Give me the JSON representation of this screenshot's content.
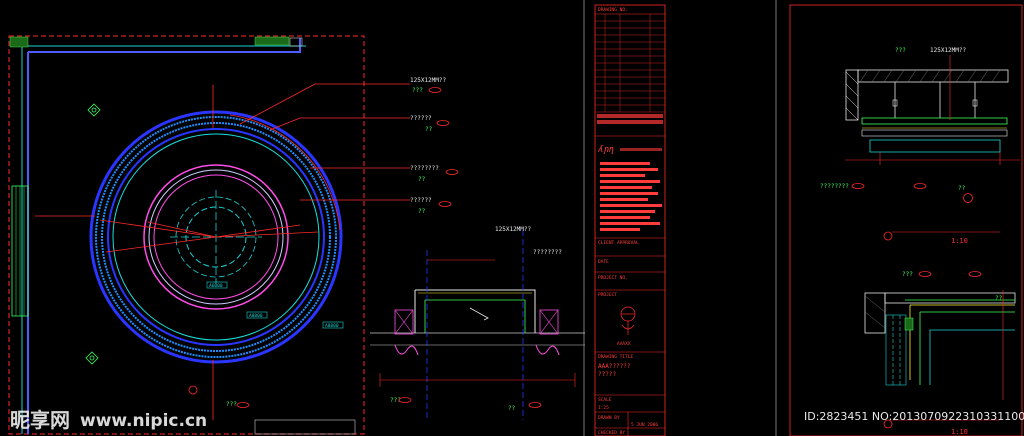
{
  "plan": {
    "dim_125": "125X12MM??",
    "ques": "???",
    "ques2": "??",
    "q_long": "????????",
    "q_mid": "??????",
    "tag_a": "A6000",
    "tag_b": "A8800",
    "tag_c": "A8800"
  },
  "section_a": {
    "dim_125": "125X12MM??",
    "q_long": "????????",
    "ques": "???",
    "ques2": "??"
  },
  "title_block": {
    "label_drawing_no": "DRAWING NO.",
    "label_client": "CLIENT APPROVAL",
    "label_date": "DATE",
    "label_project": "PROJECT NO.",
    "label_proj_title": "PROJECT",
    "label_drawing_title": "DRAWING TITLE",
    "title_value": "AAA??????",
    "title_sub": "?????",
    "label_scale": "SCALE",
    "scale_value": "1:25",
    "label_drawn": "DRAWN BY",
    "date_value": "5 JUN 2006",
    "label_checked": "CHECKED BY",
    "stamp": "AAAXX"
  },
  "detail_1": {
    "dim_125": "125X12MM??",
    "scale": "1:10",
    "ques": "???",
    "ques2": "??",
    "q_long": "????????"
  },
  "detail_2": {
    "scale": "1:10",
    "ques": "???",
    "ques2": "??"
  },
  "watermark": {
    "site_cn": "昵享网",
    "site_url": "www.nipic.cn",
    "id_text": "ID:2823451 NO:20130709223103311000"
  }
}
